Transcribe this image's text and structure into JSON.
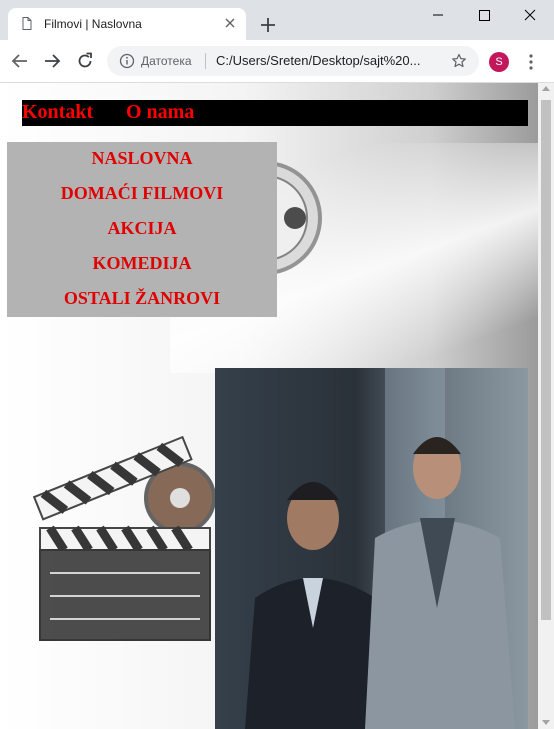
{
  "browser": {
    "tab_title": "Filmovi | Naslovna",
    "page_type_label": "Датотека",
    "url": "C:/Users/Sreten/Desktop/sajt%20...",
    "profile_initial": "S"
  },
  "page": {
    "top_links": [
      "Kontakt",
      "O nama"
    ],
    "menu": [
      "NASLOVNA",
      "DOMAĆI FILMOVI",
      "AKCIJA",
      "KOMEDIJA",
      "OSTALI ŽANROVI"
    ]
  },
  "colors": {
    "link_red": "#ff0000",
    "menu_bg": "#b3b3b3",
    "topbar_bg": "#000000",
    "profile_avatar": "#c2185b"
  }
}
